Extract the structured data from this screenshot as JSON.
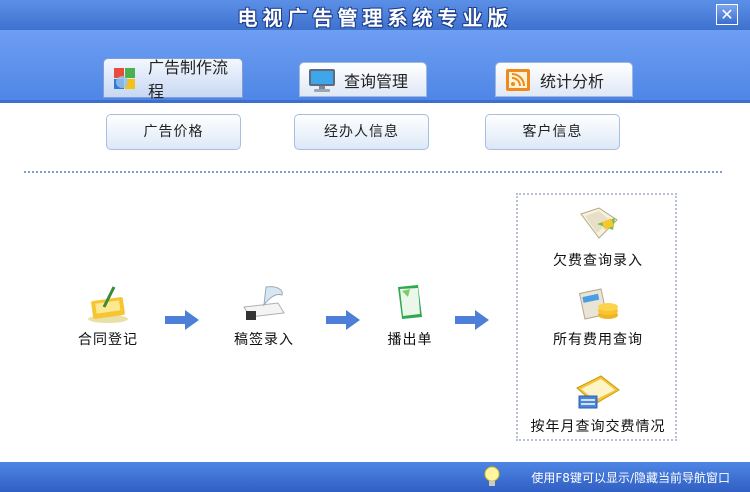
{
  "window": {
    "title": "电视广告管理系统专业版",
    "close_label": "✕"
  },
  "tabs": [
    {
      "label": "广告制作流程"
    },
    {
      "label": "查询管理"
    },
    {
      "label": "统计分析"
    }
  ],
  "subbuttons": [
    {
      "label": "广告价格"
    },
    {
      "label": "经办人信息"
    },
    {
      "label": "客户信息"
    }
  ],
  "flow": {
    "contract": "合同登记",
    "draft": "稿签录入",
    "playlist": "播出单"
  },
  "queries": {
    "arrears": "欠费查询录入",
    "all_fees": "所有费用查询",
    "monthly": "按年月查询交费情况"
  },
  "status": {
    "text": "使用F8键可以显示/隐藏当前导航窗口"
  },
  "icons": [
    "close-icon",
    "flow-icon",
    "monitor-icon",
    "stats-icon",
    "contract-icon",
    "draft-icon",
    "playlist-icon",
    "arrears-icon",
    "fees-icon",
    "monthly-icon",
    "bulb-icon",
    "arrow-right-icon"
  ]
}
